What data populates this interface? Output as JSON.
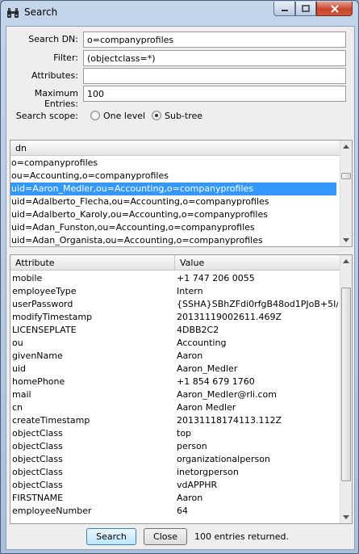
{
  "window": {
    "title": "Search",
    "icon": "binoculars-icon"
  },
  "form": {
    "search_dn_label": "Search DN:",
    "search_dn_value": "o=companyprofiles",
    "filter_label": "Filter:",
    "filter_value": "(objectclass=*)",
    "attributes_label": "Attributes:",
    "attributes_value": "",
    "max_entries_label": "Maximum Entries:",
    "max_entries_value": "100",
    "scope_label": "Search scope:",
    "scope_one_level": "One level",
    "scope_subtree": "Sub-tree",
    "scope_selected": "Sub-tree"
  },
  "dn_list": {
    "header": "dn",
    "items": [
      "o=companyprofiles",
      "ou=Accounting,o=companyprofiles",
      "uid=Aaron_Medler,ou=Accounting,o=companyprofiles",
      "uid=Adalberto_Flecha,ou=Accounting,o=companyprofiles",
      "uid=Adalberto_Karoly,ou=Accounting,o=companyprofiles",
      "uid=Adan_Funston,ou=Accounting,o=companyprofiles",
      "uid=Adan_Organista,ou=Accounting,o=companyprofiles"
    ],
    "selected_index": 2
  },
  "attr_table": {
    "col_attribute": "Attribute",
    "col_value": "Value",
    "rows": [
      [
        "mobile",
        "+1 747 206 0055"
      ],
      [
        "employeeType",
        "Intern"
      ],
      [
        "userPassword",
        "{SSHA}SBhZFdi0rfgB48od1PJoB+5I/uz..."
      ],
      [
        "modifyTimestamp",
        "20131119002611.469Z"
      ],
      [
        "LICENSEPLATE",
        "4DBB2C2"
      ],
      [
        "ou",
        "Accounting"
      ],
      [
        "givenName",
        "Aaron"
      ],
      [
        "uid",
        "Aaron_Medler"
      ],
      [
        "homePhone",
        "+1 854 679 1760"
      ],
      [
        "mail",
        "Aaron_Medler@rli.com"
      ],
      [
        "cn",
        "Aaron Medler"
      ],
      [
        "createTimestamp",
        "20131118174113.112Z"
      ],
      [
        "objectClass",
        "top"
      ],
      [
        "objectClass",
        "person"
      ],
      [
        "objectClass",
        "organizationalperson"
      ],
      [
        "objectClass",
        "inetorgperson"
      ],
      [
        "objectClass",
        "vdAPPHR"
      ],
      [
        "FIRSTNAME",
        "Aaron"
      ],
      [
        "employeeNumber",
        "64"
      ]
    ]
  },
  "footer": {
    "search_button": "Search",
    "close_button": "Close",
    "status": "100 entries returned."
  },
  "colors": {
    "selection": "#3399ff",
    "close_button": "#c7452c"
  }
}
